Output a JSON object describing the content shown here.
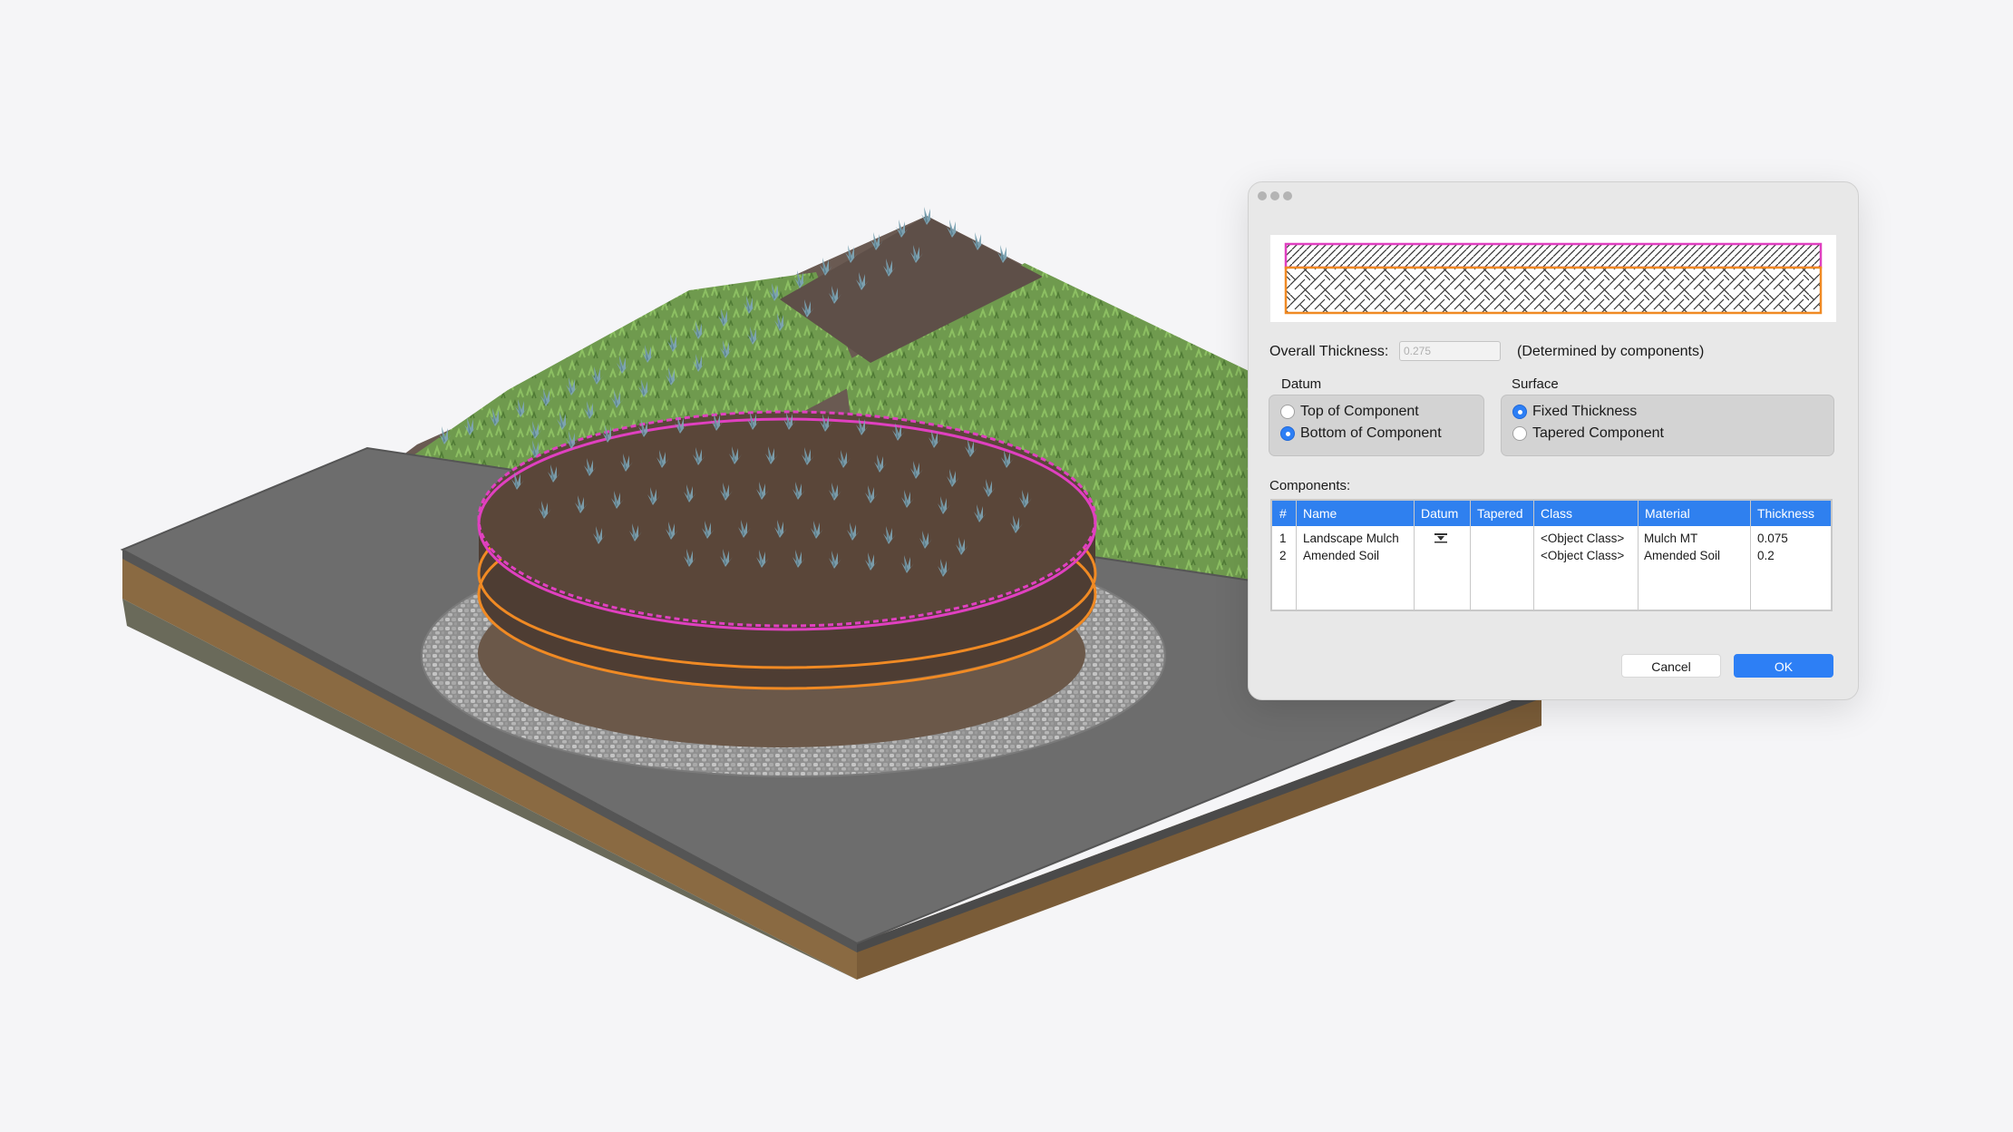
{
  "dialog": {
    "overall_thickness_label": "Overall Thickness:",
    "overall_thickness_value": "0.275",
    "determined_note": "(Determined by components)",
    "datum_title": "Datum",
    "datum_options": [
      "Top of Component",
      "Bottom of Component"
    ],
    "datum_selected": "Bottom of Component",
    "surface_title": "Surface",
    "surface_options": [
      "Fixed Thickness",
      "Tapered Component"
    ],
    "surface_selected": "Fixed Thickness",
    "components_label": "Components:",
    "table": {
      "columns": [
        "#",
        "Name",
        "Datum",
        "Tapered",
        "Class",
        "Material",
        "Thickness"
      ],
      "rows": [
        {
          "num": "1",
          "name": "Landscape Mulch",
          "datum_icon": "datum-marker-icon",
          "tapered": "",
          "class": "<Object Class>",
          "material": "Mulch MT",
          "thickness": "0.075"
        },
        {
          "num": "2",
          "name": "Amended Soil",
          "datum_icon": "",
          "tapered": "",
          "class": "<Object Class>",
          "material": "Amended Soil",
          "thickness": "0.2"
        }
      ]
    },
    "cancel_label": "Cancel",
    "ok_label": "OK"
  },
  "colors": {
    "accent": "#2f80ef",
    "top_component_outline": "#e040c0",
    "bottom_component_outline": "#f08a24",
    "background": "#f5f5f7"
  },
  "icons": [
    "window-controls",
    "datum-marker-icon"
  ]
}
